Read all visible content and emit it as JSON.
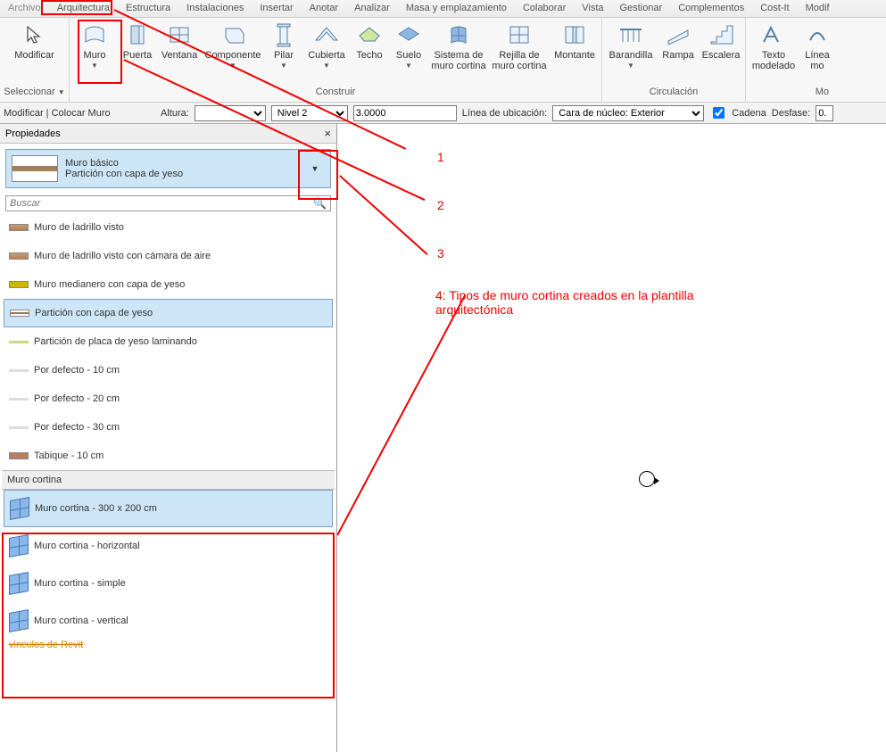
{
  "menu": {
    "tabs": [
      "Archivo",
      "Arquitectura",
      "Estructura",
      "Instalaciones",
      "Insertar",
      "Anotar",
      "Analizar",
      "Masa y emplazamiento",
      "Colaborar",
      "Vista",
      "Gestionar",
      "Complementos",
      "Cost-It",
      "Modif"
    ]
  },
  "ribbon": {
    "select": {
      "label": "Modificar",
      "footer": "Seleccionar"
    },
    "build": {
      "footer": "Construir",
      "items": [
        {
          "label": "Muro",
          "drop": true
        },
        {
          "label": "Puerta"
        },
        {
          "label": "Ventana"
        },
        {
          "label": "Componente",
          "drop": true
        },
        {
          "label": "Pilar",
          "drop": true
        },
        {
          "label": "Cubierta",
          "drop": true
        },
        {
          "label": "Techo"
        },
        {
          "label": "Suelo",
          "drop": true
        },
        {
          "label": "Sistema de\nmuro cortina"
        },
        {
          "label": "Rejilla de\nmuro cortina"
        },
        {
          "label": "Montante"
        }
      ]
    },
    "circ": {
      "footer": "Circulación",
      "items": [
        {
          "label": "Barandilla",
          "drop": true
        },
        {
          "label": "Rampa"
        },
        {
          "label": "Escalera"
        }
      ]
    },
    "model": {
      "footer": "Mo",
      "items": [
        {
          "label": "Texto\nmodelado"
        },
        {
          "label": "Línea\nmo"
        }
      ]
    }
  },
  "optbar": {
    "context": "Modificar | Colocar Muro",
    "altura_label": "Altura:",
    "altura_value": "",
    "nivel_value": "Nivel 2",
    "height_value": "3.0000",
    "loc_label": "Línea de ubicación:",
    "loc_value": "Cara de núcleo: Exterior",
    "chain_label": "Cadena",
    "chain_checked": true,
    "offset_label": "Desfase:",
    "offset_value": "0."
  },
  "props": {
    "title": "Propiedades",
    "type_family": "Muro básico",
    "type_name": "Partición con capa de yeso",
    "search_placeholder": "Buscar",
    "types": [
      {
        "name": "Muro de ladrillo visto",
        "kind": "brick"
      },
      {
        "name": "Muro de ladrillo visto con cámara de aire",
        "kind": "brick2"
      },
      {
        "name": "Muro medianero con capa de yeso",
        "kind": "yellow"
      },
      {
        "name": "Partición con capa de yeso",
        "kind": "part",
        "selected": true
      },
      {
        "name": "Partición de placa de yeso laminando",
        "kind": "green"
      },
      {
        "name": "Por defecto - 10 cm",
        "kind": "thin"
      },
      {
        "name": "Por defecto - 20 cm",
        "kind": "thin"
      },
      {
        "name": "Por defecto - 30 cm",
        "kind": "thin"
      },
      {
        "name": "Tabique - 10 cm",
        "kind": "tabique"
      }
    ],
    "cw_header": "Muro cortina",
    "cw_types": [
      {
        "name": "Muro cortina - 300 x 200 cm",
        "selected": true
      },
      {
        "name": "Muro cortina - horizontal"
      },
      {
        "name": "Muro cortina - simple"
      },
      {
        "name": "Muro cortina - vertical"
      }
    ],
    "truncated": "vinculos de Revit"
  },
  "annotations": {
    "n1": "1",
    "n2": "2",
    "n3": "3",
    "n4": "4: Tipos de muro cortina creados en la plantilla arquitectónica"
  }
}
